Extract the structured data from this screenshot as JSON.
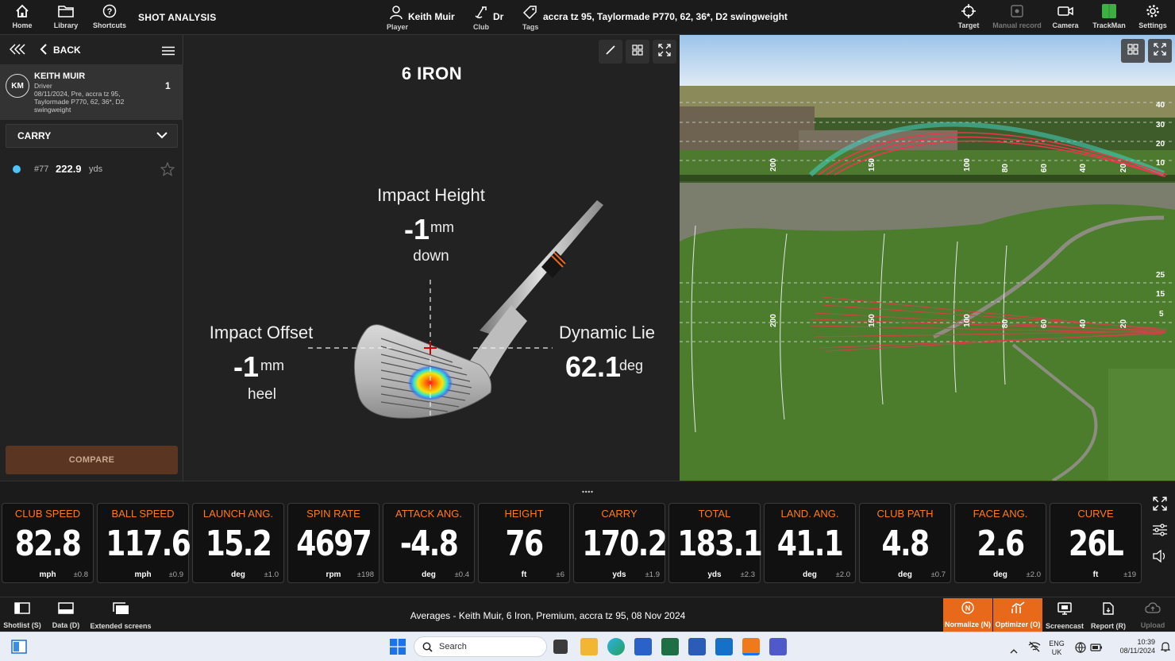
{
  "topbar": {
    "home_label": "Home",
    "library_label": "Library",
    "shortcuts_label": "Shortcuts",
    "section_title": "SHOT ANALYSIS",
    "player_value": "Keith Muir",
    "player_label": "Player",
    "club_value": "Dr",
    "club_label": "Club",
    "tags_value": "accra tz 95, Taylormade P770, 62, 36*, D2 swingweight",
    "tags_label": "Tags",
    "target_label": "Target",
    "manual_record_label": "Manual record",
    "camera_label": "Camera",
    "trackman_label": "TrackMan",
    "settings_label": "Settings"
  },
  "left_panel": {
    "back_label": "BACK",
    "player": {
      "initials": "KM",
      "name": "KEITH MUIR",
      "club": "Driver",
      "detail": "08/11/2024, Pre, accra tz 95, Taylormade P770, 62, 36*, D2 swingweight",
      "count": "1"
    },
    "metric_select": "CARRY",
    "shots": [
      {
        "number": "#77",
        "value": "222.9",
        "unit": "yds",
        "color": "#4fc3f7"
      }
    ],
    "compare_label": "COMPARE"
  },
  "impact": {
    "club_title": "6 IRON",
    "height": {
      "label": "Impact Height",
      "value": "-1",
      "unit": "mm",
      "direction": "down"
    },
    "offset": {
      "label": "Impact Offset",
      "value": "-1",
      "unit": "mm",
      "direction": "heel"
    },
    "lie": {
      "label": "Dynamic Lie",
      "value": "62.1",
      "unit": "deg"
    }
  },
  "range_view": {
    "side_scale": [
      "40",
      "30",
      "20",
      "10"
    ],
    "side_distances": [
      "200",
      "150",
      "100",
      "80",
      "60",
      "40",
      "20"
    ],
    "top_scale": [
      "25",
      "15",
      "5"
    ],
    "top_distances": [
      "200",
      "150",
      "100",
      "80",
      "60",
      "40",
      "20"
    ],
    "colors": {
      "trajectory": "#e8384f",
      "trajectory_alt": "#3fd3c3"
    }
  },
  "metrics": [
    {
      "name": "CLUB SPEED",
      "value": "82.8",
      "unit": "mph",
      "dev": "±0.8"
    },
    {
      "name": "BALL SPEED",
      "value": "117.6",
      "unit": "mph",
      "dev": "±0.9"
    },
    {
      "name": "LAUNCH ANG.",
      "value": "15.2",
      "unit": "deg",
      "dev": "±1.0"
    },
    {
      "name": "SPIN RATE",
      "value": "4697",
      "unit": "rpm",
      "dev": "±198"
    },
    {
      "name": "ATTACK ANG.",
      "value": "-4.8",
      "unit": "deg",
      "dev": "±0.4"
    },
    {
      "name": "HEIGHT",
      "value": "76",
      "unit": "ft",
      "dev": "±6"
    },
    {
      "name": "CARRY",
      "value": "170.2",
      "unit": "yds",
      "dev": "±1.9"
    },
    {
      "name": "TOTAL",
      "value": "183.1",
      "unit": "yds",
      "dev": "±2.3"
    },
    {
      "name": "LAND. ANG.",
      "value": "41.1",
      "unit": "deg",
      "dev": "±2.0"
    },
    {
      "name": "CLUB PATH",
      "value": "4.8",
      "unit": "deg",
      "dev": "±0.7"
    },
    {
      "name": "FACE ANG.",
      "value": "2.6",
      "unit": "deg",
      "dev": "±2.0"
    },
    {
      "name": "CURVE",
      "value": "26L",
      "unit": "ft",
      "dev": "±19"
    }
  ],
  "bottombar": {
    "shotlist_label": "Shotlist (S)",
    "data_label": "Data (D)",
    "extended_label": "Extended screens",
    "averages_text": "Averages - Keith Muir, 6 Iron, Premium, accra tz 95, 08 Nov 2024",
    "normalize_label": "Normalize (N)",
    "optimizer_label": "Optimizer (O)",
    "screencast_label": "Screencast",
    "report_label": "Report (R)",
    "upload_label": "Upload",
    "accent_color": "#e8691a"
  },
  "taskbar": {
    "search_placeholder": "Search",
    "lang_line1": "ENG",
    "lang_line2": "UK",
    "time": "10:39",
    "date": "08/11/2024"
  }
}
